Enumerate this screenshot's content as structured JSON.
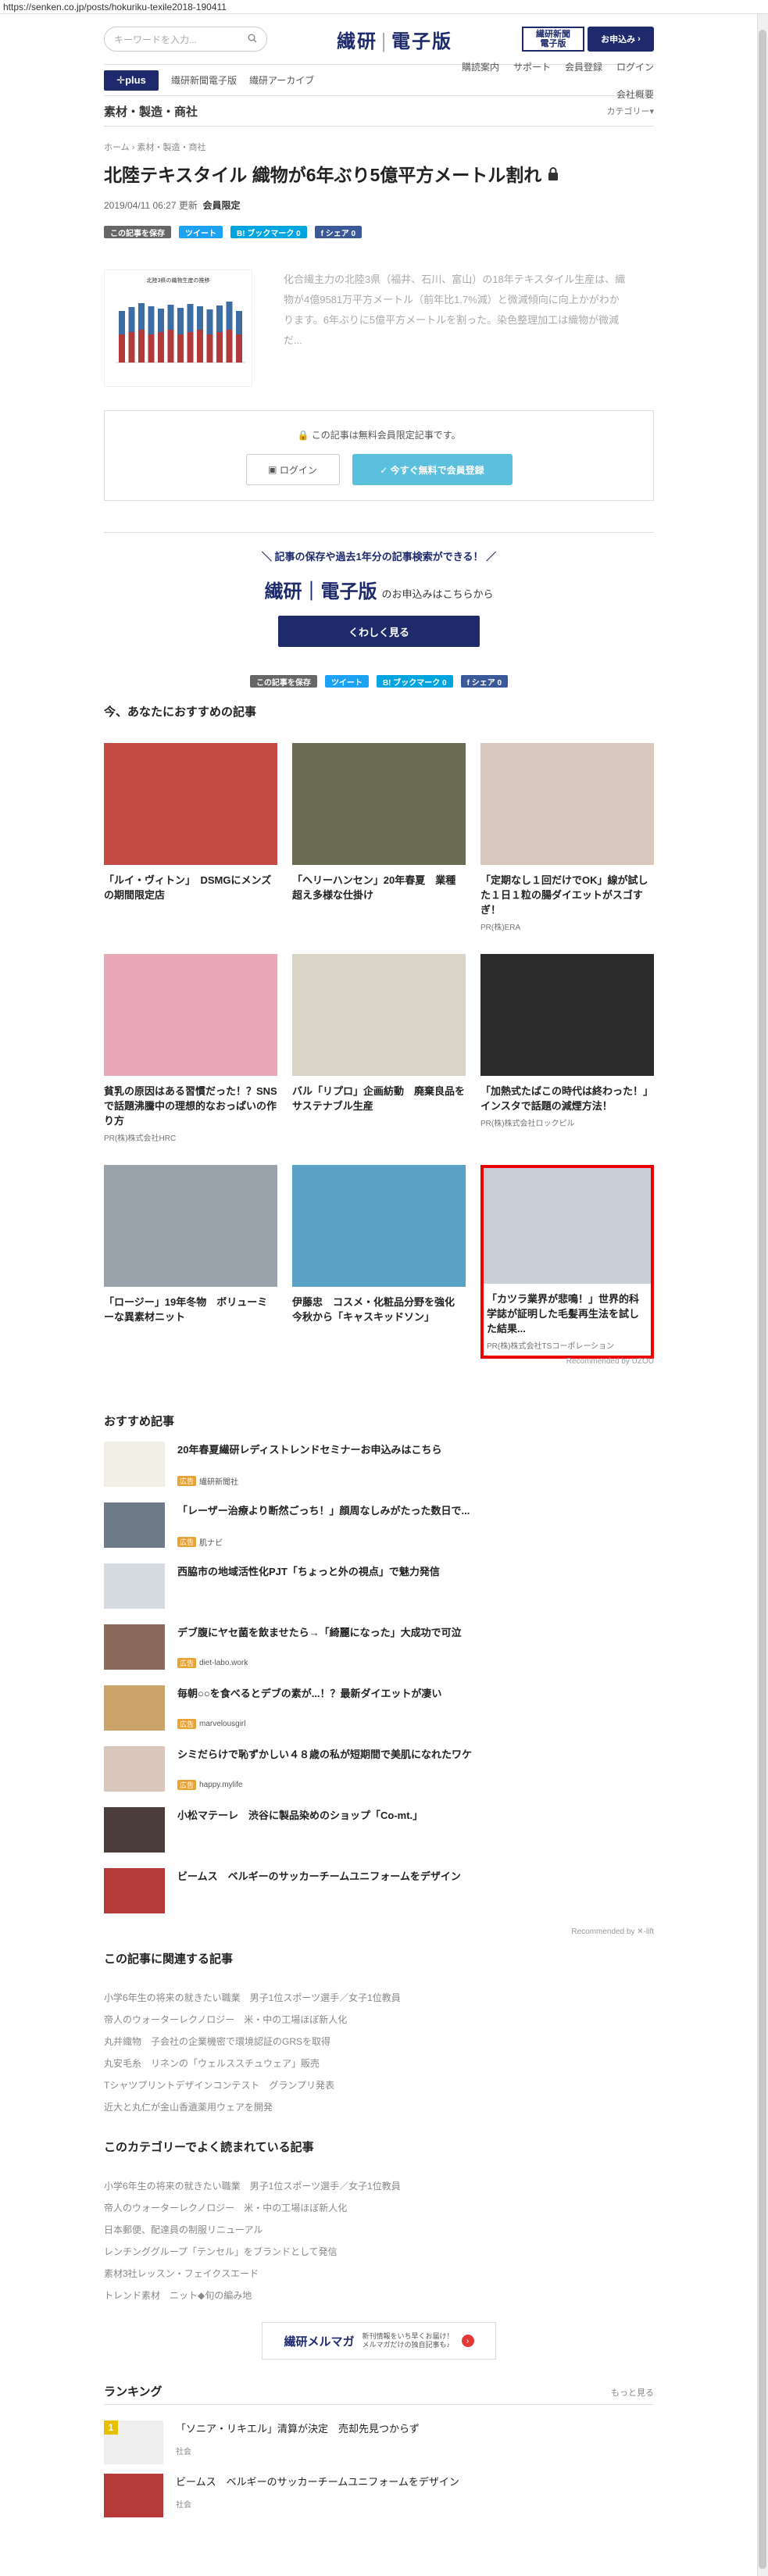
{
  "url": "https://senken.co.jp/posts/hokuriku-texile2018-190411",
  "header": {
    "search_placeholder": "キーワードを入力...",
    "logo_a": "繊研",
    "logo_b": "電子版",
    "sub_line1": "繊研新聞",
    "sub_line2": "電子版",
    "apply": "お申込み"
  },
  "nav": {
    "plus": "✛plus",
    "left": [
      "繊研新聞電子版",
      "繊研アーカイブ"
    ],
    "right": [
      "購読案内",
      "サポート",
      "会員登録",
      "ログイン",
      "会社概要"
    ]
  },
  "subnav": {
    "category": "素材・製造・商社",
    "categories": "カテゴリー▾"
  },
  "article": {
    "breadcrumb": "ホーム › 素材・製造・商社",
    "title": "北陸テキスタイル 織物が6年ぶり5億平方メートル割れ",
    "date": "2019/04/11 06:27 更新",
    "member": "会員限定",
    "lead": "化合繊主力の北陸3県（福井、石川、富山）の18年テキスタイル生産は、織物が4億9581万平方メートル（前年比1.7%減）と微減傾向に向上かがわかります。6年ぶりに5億平方メートルを割った。染色整理加工は織物が微減だ...",
    "chart_title": "北陸3県の織物生産の推移"
  },
  "share": {
    "save": "この記事を保存",
    "tweet": "ツイート",
    "hatena": "B! ブックマーク 0",
    "facebook": "f シェア 0"
  },
  "paywall": {
    "message": "🔒 この記事は無料会員限定記事です。",
    "login": "ログイン",
    "register": "✓ 今すぐ無料で会員登録"
  },
  "promo": {
    "line1": "記事の保存や過去1年分の記事検索ができる！",
    "logo": "繊研｜電子版",
    "apply_text": "のお申込みはこちらから",
    "button": "くわしく見る"
  },
  "recommend": {
    "title": "今、あなたにおすすめの記事",
    "powered": "Recommended by UZOU",
    "items": [
      {
        "caption": "「ルイ・ヴィトン」　DSMGにメンズの期間限定店",
        "pr": "",
        "color": "#c64a44"
      },
      {
        "caption": "「ヘリーハンセン」20年春夏　業種超え多様な仕掛け",
        "pr": "",
        "color": "#6b6a52"
      },
      {
        "caption": "「定期なし１回だけでOK」線が試した１日１粒の腸ダイエットがスゴすぎ！",
        "pr": "PR(株)ERA",
        "color": "#d8c8c0"
      },
      {
        "caption": "貧乳の原因はある習慣だった！？SNSで話題沸騰中の理想的なおっぱいの作り方",
        "pr": "PR(株)株式会社HRC",
        "color": "#e9a7b6"
      },
      {
        "caption": "バル「リプロ」企画紡動　廃棄良品をサステナブル生産",
        "pr": "",
        "color": "#d9d4c8"
      },
      {
        "caption": "「加熱式たばこの時代は終わった！」インスタで話題の減煙方法！",
        "pr": "PR(株)株式会社ロックピル",
        "color": "#2b2b2b"
      },
      {
        "caption": "「ロージー」19年冬物　ボリューミーな異素材ニット",
        "pr": "",
        "color": "#9aa3ac"
      },
      {
        "caption": "伊藤忠　コスメ・化粧品分野を強化　今秋から「キャスキッドソン」",
        "pr": "",
        "color": "#5aa3c6"
      },
      {
        "caption": "「カツラ業界が悲鳴！」世界的科学誌が証明した毛髪再生法を試した結果...",
        "pr": "PR(株)株式会社TSコーポレーション",
        "color": "#c9cfd6"
      }
    ]
  },
  "osusume": {
    "title": "おすすめ記事",
    "powered": "Recommended by ✕-lift",
    "ad_label": "広告",
    "items": [
      {
        "title": "20年春夏繊研レディストレンドセミナーお申込みはこちら",
        "source": "繊研新聞社",
        "ad": true,
        "color": "#f1efe6"
      },
      {
        "title": "「レーザー治療より断然ごっち！」顔周なしみがたった数日で...",
        "source": "肌ナビ",
        "ad": true,
        "color": "#6e7a88"
      },
      {
        "title": "西脇市の地域活性化PJT「ちょっと外の視点」で魅力発信",
        "source": "",
        "ad": false,
        "color": "#d5dbe0"
      },
      {
        "title": "デブ腹にヤセ菌を飲ませたら→「綺麗になった」大成功で可泣",
        "source": "diet-labo.work",
        "ad": true,
        "color": "#8a6a5a"
      },
      {
        "title": "毎朝○○を食べるとデブの素が...！？最新ダイエットが凄い",
        "source": "marvelousgirl",
        "ad": true,
        "color": "#c9a36a"
      },
      {
        "title": "シミだらけで恥ずかしい４８歳の私が短期間で美肌になれたワケ",
        "source": "happy.mylife",
        "ad": true,
        "color": "#d9c6bd"
      },
      {
        "title": "小松マテーレ　渋谷に製品染めのショップ「Co-mt.」",
        "source": "",
        "ad": false,
        "color": "#4a3d3a"
      },
      {
        "title": "ビームス　ベルギーのサッカーチームユニフォームをデザイン",
        "source": "",
        "ad": false,
        "color": "#b63a3a"
      }
    ]
  },
  "related": {
    "title": "この記事に関連する記事",
    "links": [
      "小学6年生の将来の就きたい職業　男子1位スポーツ選手／女子1位教員",
      "帝人のウォーターレクノロジー　米・中の工場ほぼ新人化",
      "丸井織物　子会社の企業機密で環境認証のGRSを取得",
      "丸安毛糸　リネンの「ウェルススチュウェア」販売",
      "Tシャツプリントデザインコンテスト　グランプリ発表",
      "近大と丸仁が金山香遺薬用ウェアを開発"
    ]
  },
  "popular": {
    "title": "このカテゴリーでよく読まれている記事",
    "links": [
      "小学6年生の将来の就きたい職業　男子1位スポーツ選手／女子1位教員",
      "帝人のウォーターレクノロジー　米・中の工場ほぼ新人化",
      "日本郵便、配達員の制服リニューアル",
      "レンチンググループ「テンセル」をブランドとして発信",
      "素材3社レッスン・フェイクスエード",
      "トレンド素材　ニット◆旬の編み地"
    ]
  },
  "mailmag": {
    "logo": "繊研メルマガ",
    "sub1": "新刊情報をいち早くお届け！",
    "sub2": "メルマガだけの独自記事も♪",
    "icon": "›"
  },
  "ranking": {
    "title": "ランキング",
    "more": "もっと見る",
    "items": [
      {
        "num": "1",
        "title": "「ソニア・リキエル」清算が決定　売却先見つからず",
        "cat": "社会"
      },
      {
        "num": "",
        "title": "ビームス　ベルギーのサッカーチームユニフォームをデザイン",
        "cat": "社会"
      }
    ]
  }
}
